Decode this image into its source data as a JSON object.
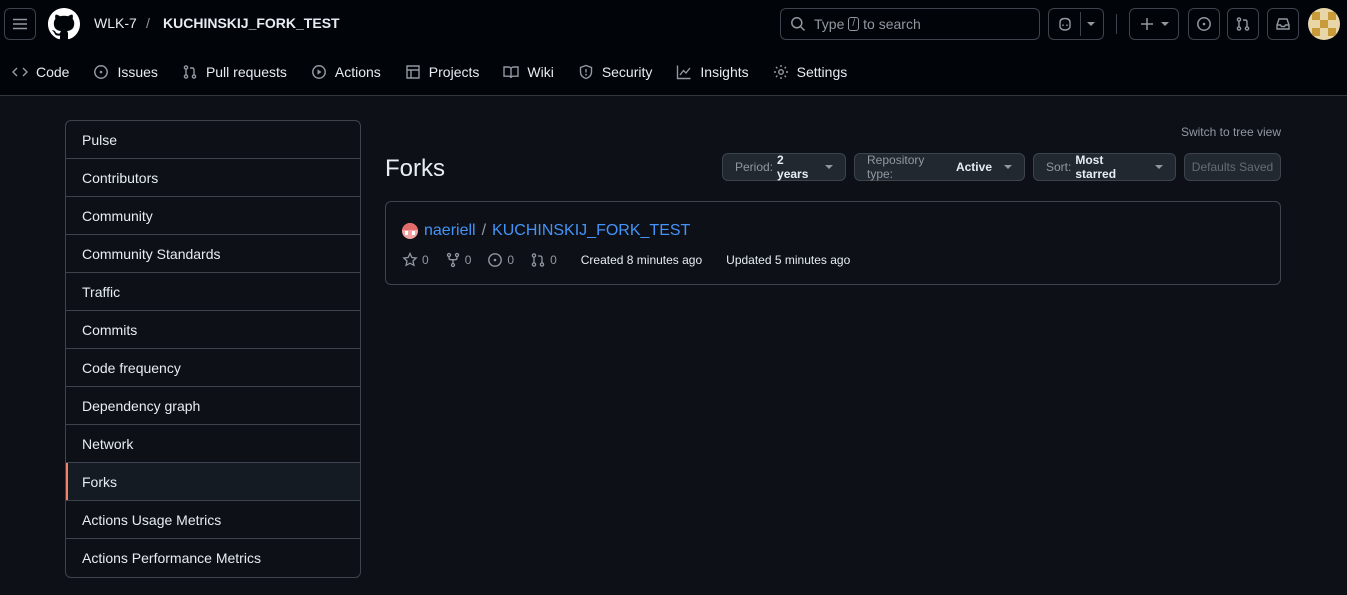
{
  "header": {
    "owner": "WLK-7",
    "slash": "/",
    "repo": "KUCHINSKIJ_FORK_TEST",
    "search": {
      "prefix": "Type",
      "key": "/",
      "suffix": "to search"
    }
  },
  "nav": [
    {
      "label": "Code",
      "icon": "code-icon"
    },
    {
      "label": "Issues",
      "icon": "issue-icon"
    },
    {
      "label": "Pull requests",
      "icon": "pull-request-icon"
    },
    {
      "label": "Actions",
      "icon": "play-icon"
    },
    {
      "label": "Projects",
      "icon": "table-icon"
    },
    {
      "label": "Wiki",
      "icon": "book-icon"
    },
    {
      "label": "Security",
      "icon": "shield-icon"
    },
    {
      "label": "Insights",
      "icon": "graph-icon"
    },
    {
      "label": "Settings",
      "icon": "gear-icon"
    }
  ],
  "sidebar": [
    {
      "label": "Pulse"
    },
    {
      "label": "Contributors"
    },
    {
      "label": "Community"
    },
    {
      "label": "Community Standards"
    },
    {
      "label": "Traffic"
    },
    {
      "label": "Commits"
    },
    {
      "label": "Code frequency"
    },
    {
      "label": "Dependency graph"
    },
    {
      "label": "Network"
    },
    {
      "label": "Forks",
      "active": true
    },
    {
      "label": "Actions Usage Metrics"
    },
    {
      "label": "Actions Performance Metrics"
    }
  ],
  "main": {
    "title": "Forks",
    "switch_view": "Switch to tree view",
    "period": {
      "label": "Period:",
      "value": "2 years"
    },
    "repo_type": {
      "label": "Repository type:",
      "value": "Active"
    },
    "sort": {
      "label": "Sort:",
      "value": "Most starred"
    },
    "defaults": "Defaults Saved"
  },
  "fork": {
    "owner": "naeriell",
    "slash": "/",
    "name": "KUCHINSKIJ_FORK_TEST",
    "stars": "0",
    "forks": "0",
    "issues": "0",
    "pulls": "0",
    "created": "Created 8 minutes ago",
    "updated": "Updated 5 minutes ago"
  },
  "colors": {
    "accent_link": "#4493f8",
    "active_marker": "#f78166",
    "background": "#0d1117"
  }
}
